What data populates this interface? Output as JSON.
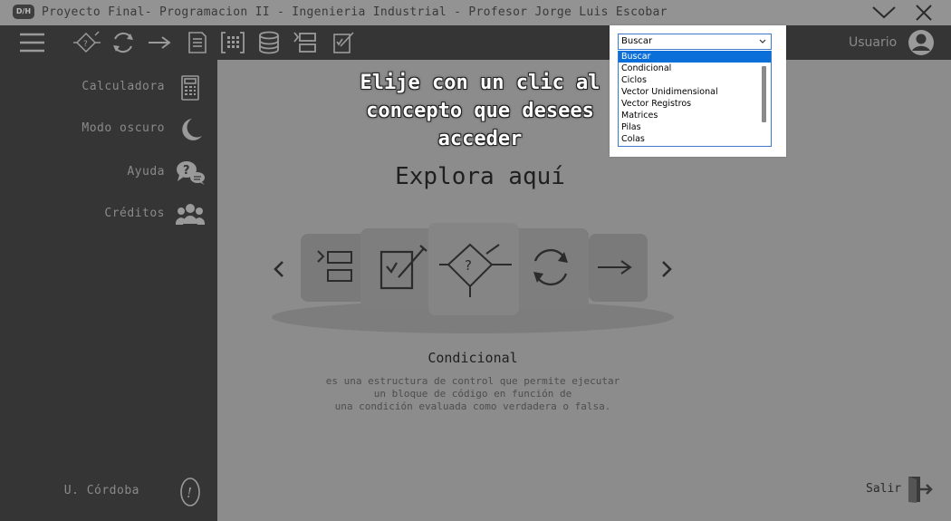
{
  "window": {
    "app_icon_text": "D/H",
    "title": "Proyecto Final- Programacion II - Ingenieria Industrial - Profesor Jorge Luis Escobar"
  },
  "toolbar": {
    "tools": [
      "menu-icon",
      "decision-icon",
      "cycle-icon",
      "arrow-right-icon",
      "document-icon",
      "array-icon",
      "database-icon",
      "stack-icon",
      "edit-icon"
    ],
    "user_label": "Usuario"
  },
  "sidebar": {
    "items": [
      {
        "label": "Calculadora",
        "icon": "calculator-icon"
      },
      {
        "label": "Modo oscuro",
        "icon": "moon-icon"
      },
      {
        "label": "Ayuda",
        "icon": "help-chat-icon"
      },
      {
        "label": "Créditos",
        "icon": "group-icon"
      }
    ],
    "footer_label": "U. Córdoba",
    "footer_icon": "info-icon"
  },
  "main": {
    "instruction": "Elije con un clic al\nconcepto que desees\nacceder",
    "heading": "Explora aquí",
    "concept_title": "Condicional",
    "concept_description": "es una estructura de control que permite ejecutar\nun bloque de código en función de\nuna condición evaluada como verdadera o falsa.",
    "exit_label": "Salir"
  },
  "search": {
    "selected": "Buscar",
    "options": [
      "Buscar",
      "Condicional",
      "Ciclos",
      "Vector Unidimensional",
      "Vector Registros",
      "Matrices",
      "Pilas",
      "Colas"
    ],
    "highlighted_index": 0
  },
  "colors": {
    "titlebar": "#939393",
    "dark_panel": "#353535",
    "main_bg": "#8c8c8c",
    "card": "#7a7a7a",
    "selection": "#0a6fd8"
  }
}
